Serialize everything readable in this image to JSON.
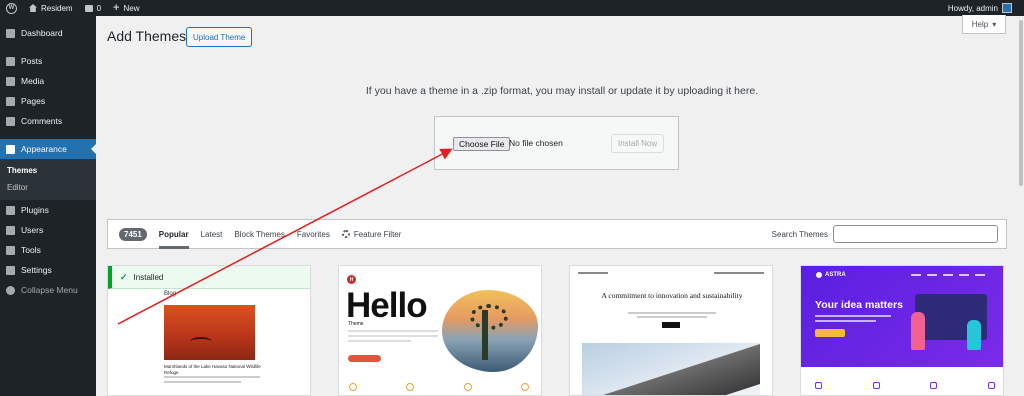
{
  "adminbar": {
    "site_name": "Residem",
    "comment_count": "0",
    "new_label": "New",
    "howdy": "Howdy, admin"
  },
  "sidebar": {
    "items": [
      {
        "label": "Dashboard",
        "icon": "dashboard-icon"
      },
      {
        "label": "Posts",
        "icon": "pin-icon"
      },
      {
        "label": "Media",
        "icon": "media-icon"
      },
      {
        "label": "Pages",
        "icon": "pages-icon"
      },
      {
        "label": "Comments",
        "icon": "comments-icon"
      },
      {
        "label": "Appearance",
        "icon": "brush-icon"
      },
      {
        "label": "Plugins",
        "icon": "plugin-icon"
      },
      {
        "label": "Users",
        "icon": "users-icon"
      },
      {
        "label": "Tools",
        "icon": "wrench-icon"
      },
      {
        "label": "Settings",
        "icon": "settings-icon"
      },
      {
        "label": "Collapse Menu",
        "icon": "collapse-icon"
      }
    ],
    "submenu": [
      "Themes",
      "Editor"
    ]
  },
  "help": {
    "label": "Help"
  },
  "page": {
    "title": "Add Themes",
    "upload_button": "Upload Theme",
    "upload_help": "If you have a theme in a .zip format, you may install or update it by uploading it here.",
    "choose_file": "Choose File",
    "no_file": "No file chosen",
    "install_now": "Install Now"
  },
  "filters": {
    "count": "7451",
    "tabs": [
      "Popular",
      "Latest",
      "Block Themes",
      "Favorites"
    ],
    "feature_filter": "Feature Filter",
    "search_label": "Search Themes",
    "search_value": ""
  },
  "cards": {
    "installed": "Installed",
    "blog_label": "Blog",
    "blog_caption": "Marshlands of the Lake Havasu National Wildlife Refuge",
    "hello_title": "Hello",
    "hello_sub": "Theme",
    "hello_logo": "H",
    "tt_heading": "A commitment to innovation and sustainability",
    "astra_logo": "ASTRA",
    "astra_title": "Your idea matters"
  },
  "colors": {
    "admin_bar": "#1d2327",
    "accent": "#2271b1",
    "annotation": "#e02020"
  }
}
